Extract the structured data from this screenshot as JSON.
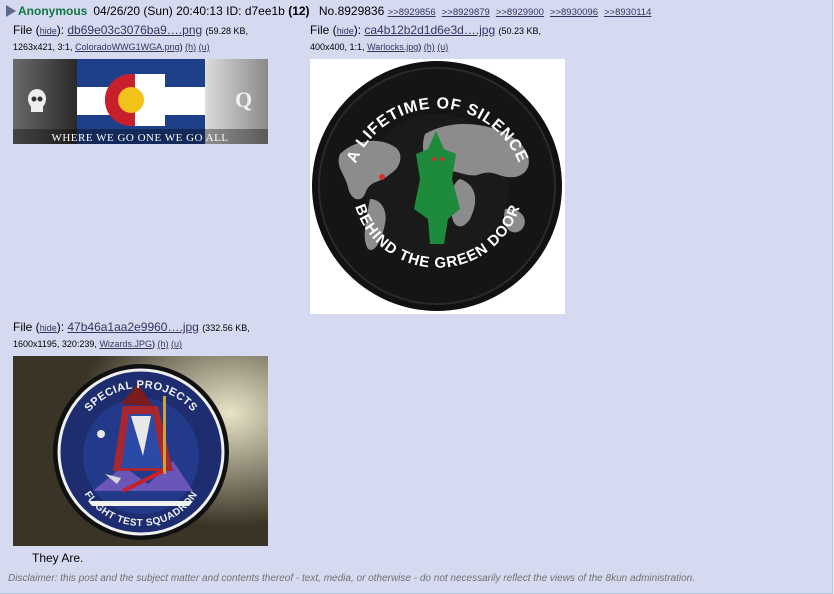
{
  "post": {
    "name": "Anonymous",
    "date": "04/26/20 (Sun) 20:40:13",
    "id_label": "ID:",
    "id": "d7ee1b",
    "id_count": "(12)",
    "number": "No.8929836",
    "backlinks": [
      ">>8929856",
      ">>8929879",
      ">>8929900",
      ">>8930096",
      ">>8930114"
    ],
    "message": "They Are.",
    "disclaimer": "Disclaimer: this post and the subject matter and contents thereof - text, media, or otherwise - do not necessarily reflect the views of the 8kun administration."
  },
  "files": [
    {
      "label": "File",
      "hide": "hide",
      "filename": "db69e03c3076ba9….png",
      "size": "(59.28 KB,",
      "meta": "1263x421, 3:1,",
      "original": "ColoradoWWG1WGA.png",
      "h": "(h)",
      "u": "(u)",
      "banner_text": "WHERE WE GO ONE WE GO ALL",
      "banner_letter": "Q"
    },
    {
      "label": "File",
      "hide": "hide",
      "filename": "ca4b12b2d1d6e3d….jpg",
      "size": "(50.23 KB,",
      "meta": "400x400, 1:1,",
      "original": "Warlocks.jpg",
      "h": "(h)",
      "u": "(u)",
      "patch_top": "A LIFETIME OF SILENCE",
      "patch_bottom": "BEHIND THE GREEN DOOR"
    },
    {
      "label": "File",
      "hide": "hide",
      "filename": "47b46a1aa2e9960….jpg",
      "size": "(332.56 KB,",
      "meta": "1600x1195, 320:239,",
      "original": "Wizards.JPG",
      "h": "(h)",
      "u": "(u)",
      "patch_top": "SPECIAL PROJECTS",
      "patch_bottom": "FLIGHT TEST SQUADRON"
    }
  ],
  "colors": {
    "post_bg": "#d6daf0",
    "name": "#117743",
    "link": "#34345c",
    "green_patch": "#1e8a3c"
  }
}
